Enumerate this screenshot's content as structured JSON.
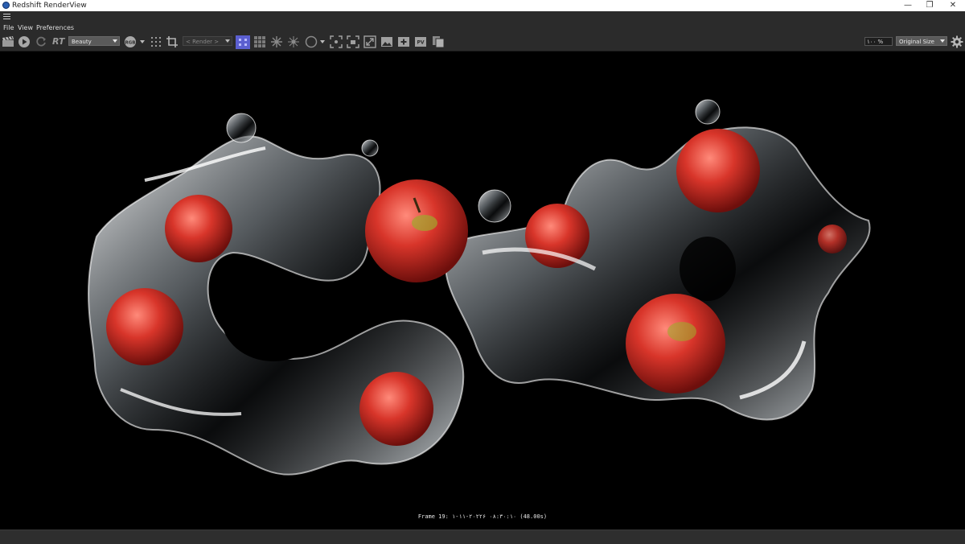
{
  "window": {
    "title": "Redshift RenderView",
    "minimize": "—",
    "restore": "❐",
    "close": "✕"
  },
  "menu": [
    "File",
    "View",
    "Preferences"
  ],
  "toolbar": {
    "rt_label": "RT",
    "aov_select": "Beauty",
    "channel_label": "RGB",
    "render_select": "< Render >",
    "zoom_value": "١٠٠ %",
    "size_select": "Original Size"
  },
  "viewport": {
    "frame_info": "Frame 19: ٢٠٢٢-١١-١۶ ٠٨:٣٠:١٠ (48.00s)"
  },
  "colors": {
    "accent": "#5b5fd0",
    "toolbar_bg": "#2b2b2b",
    "viewport_bg": "#000000"
  }
}
